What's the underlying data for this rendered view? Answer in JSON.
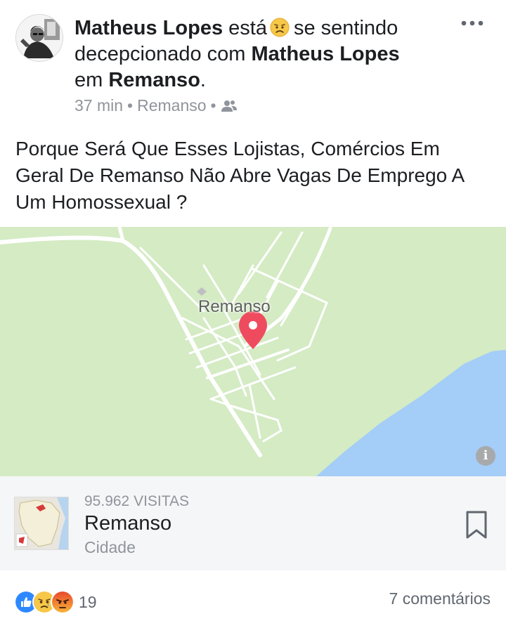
{
  "post": {
    "author": "Matheus Lopes",
    "feeling_pre": "está",
    "feeling_text": "se sentindo decepcionado com",
    "tagged": "Matheus Lopes",
    "location_pre": "em",
    "location": "Remanso",
    "period": ".",
    "time": "37 min",
    "meta_location": "Remanso",
    "audience_icon": "friends-icon",
    "body": "Porque Será Que Esses Lojistas, Comércios Em Geral De Remanso Não Abre Vagas De Emprego A Um Homossexual ?"
  },
  "map": {
    "label": "Remanso",
    "info_glyph": "i",
    "colors": {
      "land": "#d4ebc4",
      "water": "#a4cdf7",
      "road": "#ffffff",
      "pin": "#ef4b5f"
    }
  },
  "place": {
    "visits": "95.962 VISITAS",
    "name": "Remanso",
    "type": "Cidade"
  },
  "footer": {
    "reactions": [
      "like-icon",
      "sad-icon",
      "angry-icon"
    ],
    "reaction_count": "19",
    "comments": "7 comentários"
  }
}
